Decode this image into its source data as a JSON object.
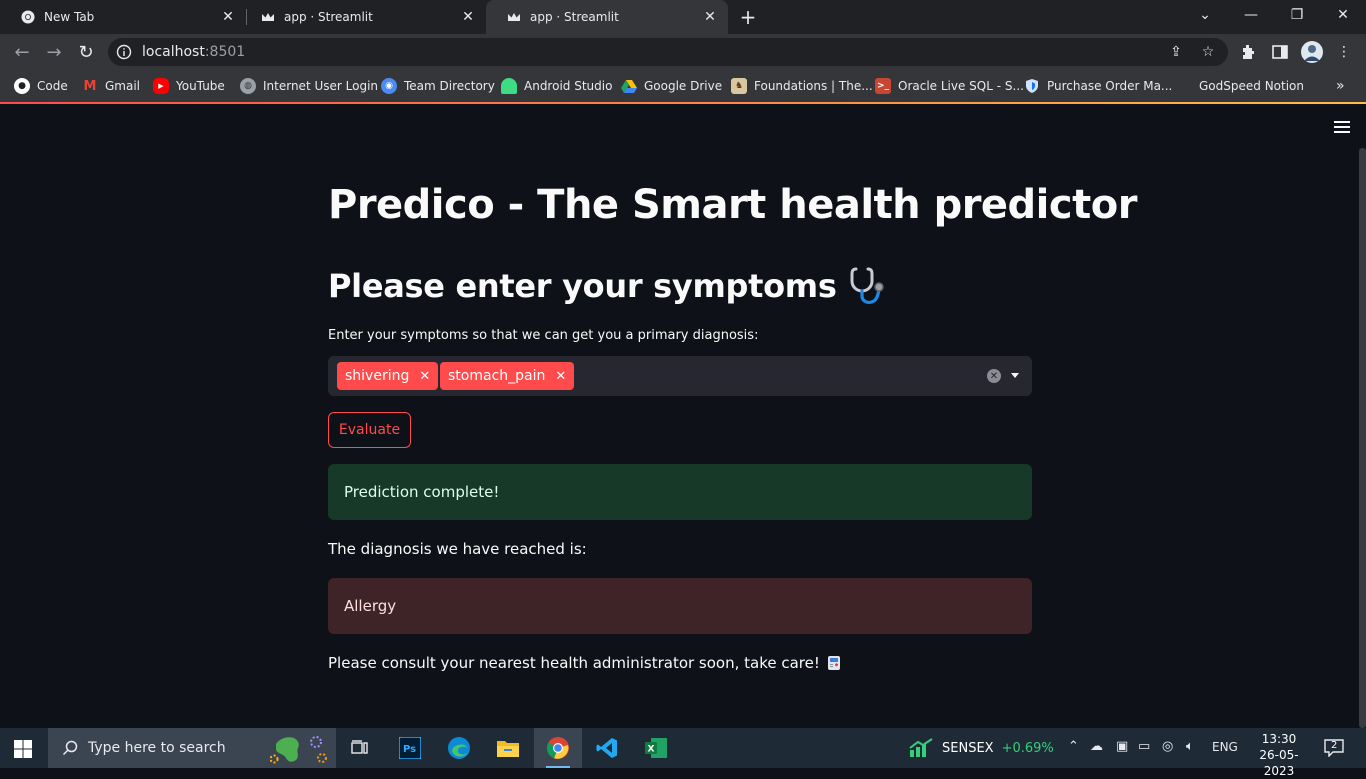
{
  "browser": {
    "tabs": [
      {
        "title": "New Tab",
        "active": false
      },
      {
        "title": "app · Streamlit",
        "active": false
      },
      {
        "title": "app · Streamlit",
        "active": true
      }
    ],
    "url_host": "localhost",
    "url_port": ":8501",
    "bookmarks": [
      {
        "label": "Code",
        "icon": "github-icon"
      },
      {
        "label": "Gmail",
        "icon": "gmail-icon"
      },
      {
        "label": "YouTube",
        "icon": "youtube-icon"
      },
      {
        "label": "Internet User Login",
        "icon": "globe-icon"
      },
      {
        "label": "Team Directory",
        "icon": "people-icon"
      },
      {
        "label": "Android Studio",
        "icon": "android-icon"
      },
      {
        "label": "Google Drive",
        "icon": "drive-icon"
      },
      {
        "label": "Foundations | The...",
        "icon": "owl-icon"
      },
      {
        "label": "Oracle Live SQL - S...",
        "icon": "terminal-icon"
      },
      {
        "label": "Purchase Order Ma...",
        "icon": "shield-icon"
      },
      {
        "label": "GodSpeed Notion",
        "icon": ""
      }
    ]
  },
  "app": {
    "title": "Predico - The Smart health predictor",
    "subtitle": "Please enter your symptoms",
    "input_label": "Enter your symptoms so that we can get you a primary diagnosis:",
    "selected_symptoms": [
      "shivering",
      "stomach_pain"
    ],
    "evaluate_label": "Evaluate",
    "success_message": "Prediction complete!",
    "diagnosis_intro": "The diagnosis we have reached is:",
    "diagnosis": "Allergy",
    "closing_message": "Please consult your nearest health administrator soon, take care!",
    "accent_color": "#ff4b4b"
  },
  "taskbar": {
    "search_placeholder": "Type here to search",
    "ticker_name": "SENSEX",
    "ticker_change": "+0.69%",
    "language": "ENG",
    "time": "13:30",
    "date": "26-05-2023",
    "notification_count": "2"
  }
}
